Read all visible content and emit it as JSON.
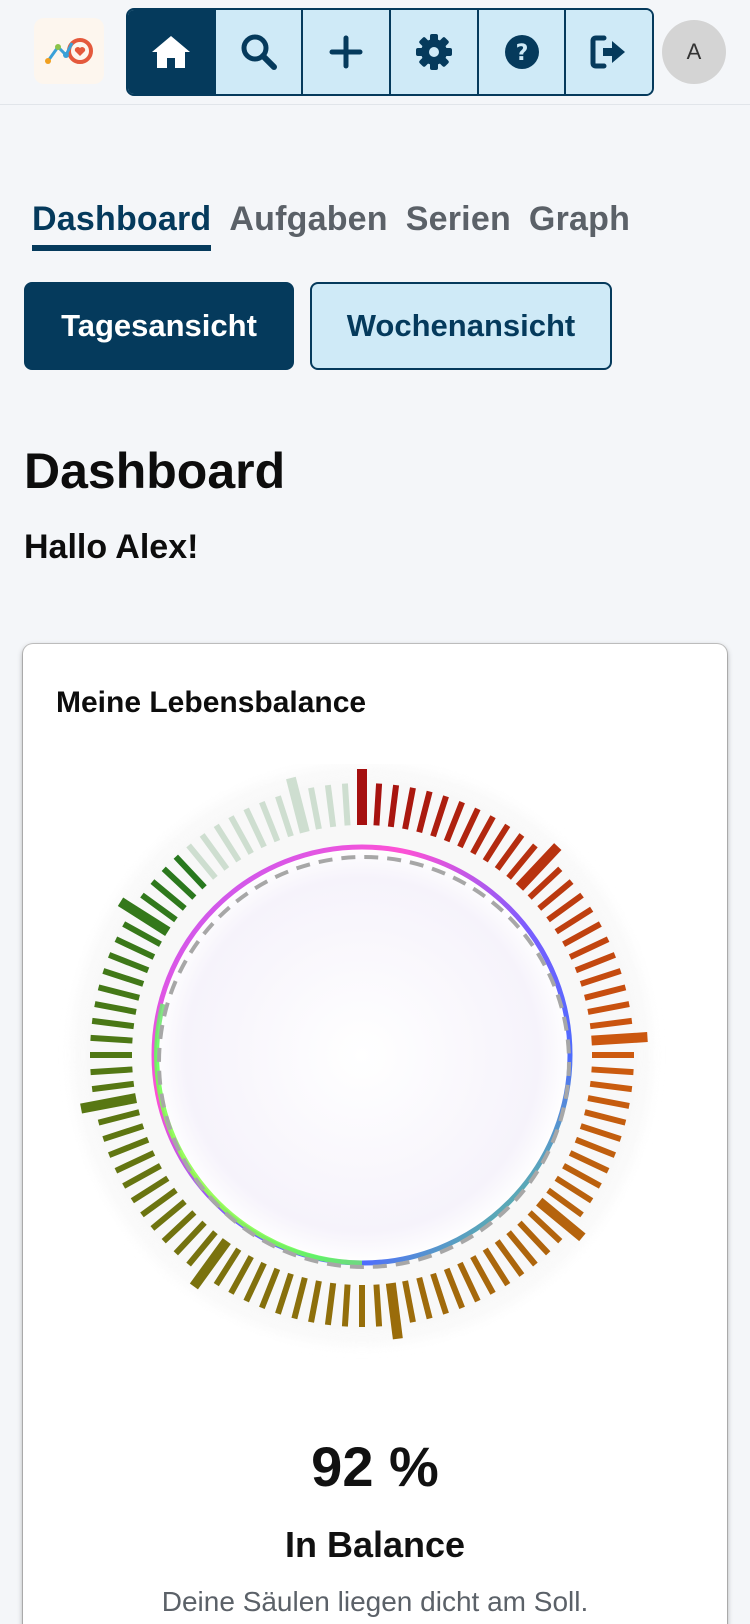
{
  "header": {
    "toolbar": [
      {
        "name": "home",
        "icon": "home-icon",
        "active": true
      },
      {
        "name": "search",
        "icon": "search-icon",
        "active": false
      },
      {
        "name": "add",
        "icon": "plus-icon",
        "active": false
      },
      {
        "name": "settings",
        "icon": "gear-icon",
        "active": false
      },
      {
        "name": "help",
        "icon": "question-circle-icon",
        "active": false
      },
      {
        "name": "logout",
        "icon": "sign-out-icon",
        "active": false
      }
    ],
    "avatar_initial": "A"
  },
  "tabs": [
    "Dashboard",
    "Aufgaben",
    "Serien",
    "Graph"
  ],
  "active_tab": "Dashboard",
  "views": {
    "day": "Tagesansicht",
    "week": "Wochenansicht"
  },
  "page_title": "Dashboard",
  "greeting": "Hallo Alex!",
  "balance": {
    "title": "Meine Lebensbalance",
    "percent_label": "92 %",
    "percent": 92,
    "status": "In Balance",
    "description": "Deine Säulen liegen dicht am Soll."
  },
  "colors": {
    "primary": "#053a5c",
    "light": "#cfeaf7"
  }
}
